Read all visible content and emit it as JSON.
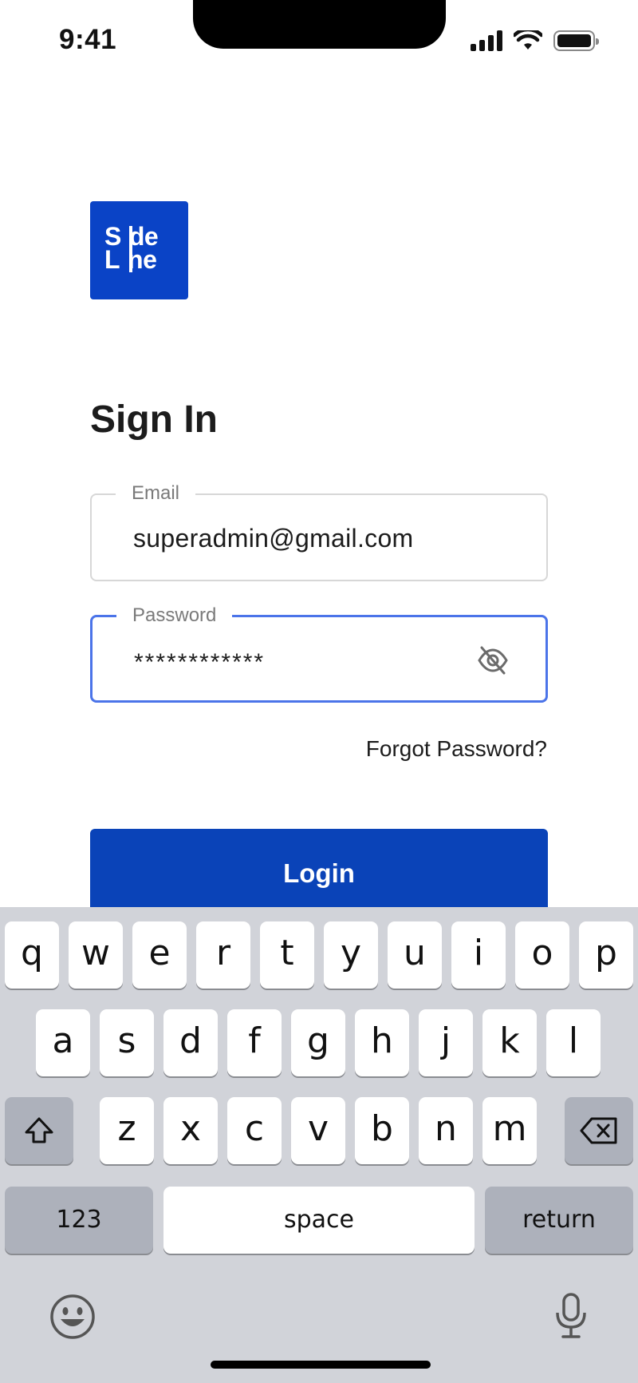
{
  "status_bar": {
    "time": "9:41"
  },
  "logo": {
    "line1": "S",
    "line1b": "de",
    "line2": "L",
    "line2b": "ne"
  },
  "title": "Sign In",
  "email": {
    "label": "Email",
    "value": "superadmin@gmail.com"
  },
  "password": {
    "label": "Password",
    "value": "************"
  },
  "forgot_label": "Forgot Password?",
  "login_label": "Login",
  "keyboard": {
    "row1": [
      "q",
      "w",
      "e",
      "r",
      "t",
      "y",
      "u",
      "i",
      "o",
      "p"
    ],
    "row2": [
      "a",
      "s",
      "d",
      "f",
      "g",
      "h",
      "j",
      "k",
      "l"
    ],
    "row3": [
      "z",
      "x",
      "c",
      "v",
      "b",
      "n",
      "m"
    ],
    "numbers_label": "123",
    "space_label": "space",
    "return_label": "return"
  },
  "colors": {
    "brand": "#0a43c6",
    "button": "#0a43b8",
    "focus_border": "#4b74e9",
    "keyboard_bg": "#d1d3d9"
  }
}
